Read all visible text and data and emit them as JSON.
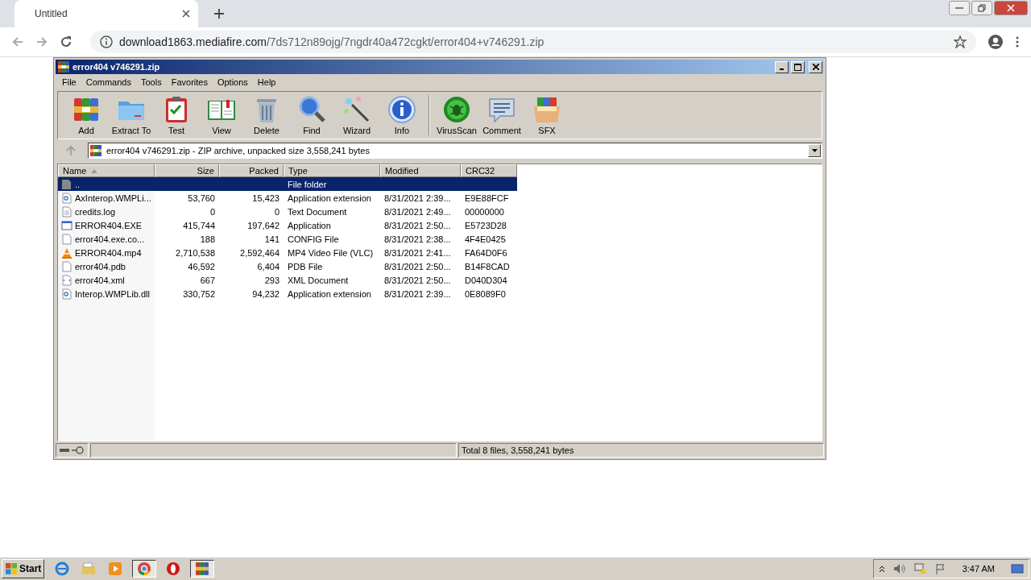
{
  "browser": {
    "tab": {
      "title": "Untitled"
    },
    "address": {
      "host": "download1863.mediafire.com",
      "path": "/7ds712n89ojg/7ngdr40a472cgkt/error404+v746291.zip"
    }
  },
  "window": {
    "title": "error404 v746291.zip",
    "menu": [
      "File",
      "Commands",
      "Tools",
      "Favorites",
      "Options",
      "Help"
    ],
    "toolbar": [
      {
        "label": "Add",
        "kind": "add"
      },
      {
        "label": "Extract To",
        "kind": "extract"
      },
      {
        "label": "Test",
        "kind": "test"
      },
      {
        "label": "View",
        "kind": "view"
      },
      {
        "label": "Delete",
        "kind": "delete"
      },
      {
        "label": "Find",
        "kind": "find"
      },
      {
        "label": "Wizard",
        "kind": "wizard"
      },
      {
        "label": "Info",
        "kind": "info"
      },
      {
        "label": "VirusScan",
        "kind": "virus",
        "group_start": true
      },
      {
        "label": "Comment",
        "kind": "comment"
      },
      {
        "label": "SFX",
        "kind": "sfx"
      }
    ],
    "path": "error404 v746291.zip - ZIP archive, unpacked size 3,558,241 bytes",
    "table": {
      "columns": [
        {
          "label": "Name",
          "sorted": true
        },
        {
          "label": "Size",
          "sorted": false
        },
        {
          "label": "Packed",
          "sorted": false
        },
        {
          "label": "Type",
          "sorted": false
        },
        {
          "label": "Modified",
          "sorted": false
        },
        {
          "label": "CRC32",
          "sorted": false
        }
      ],
      "rows": [
        {
          "kind": "folder",
          "name": "..",
          "size": "",
          "packed": "",
          "type": "File folder",
          "modified": "",
          "crc": "",
          "selected": true
        },
        {
          "kind": "dll",
          "name": "AxInterop.WMPLi...",
          "size": "53,760",
          "packed": "15,423",
          "type": "Application extension",
          "modified": "8/31/2021 2:39...",
          "crc": "E9E88FCF",
          "selected": false
        },
        {
          "kind": "text",
          "name": "credits.log",
          "size": "0",
          "packed": "0",
          "type": "Text Document",
          "modified": "8/31/2021 2:49...",
          "crc": "00000000",
          "selected": false
        },
        {
          "kind": "exe",
          "name": "ERROR404.EXE",
          "size": "415,744",
          "packed": "197,642",
          "type": "Application",
          "modified": "8/31/2021 2:50...",
          "crc": "E5723D28",
          "selected": false
        },
        {
          "kind": "blank",
          "name": "error404.exe.co...",
          "size": "188",
          "packed": "141",
          "type": "CONFIG File",
          "modified": "8/31/2021 2:38...",
          "crc": "4F4E0425",
          "selected": false
        },
        {
          "kind": "video",
          "name": "ERROR404.mp4",
          "size": "2,710,538",
          "packed": "2,592,464",
          "type": "MP4 Video File (VLC)",
          "modified": "8/31/2021 2:41...",
          "crc": "FA64D0F6",
          "selected": false
        },
        {
          "kind": "blank",
          "name": "error404.pdb",
          "size": "46,592",
          "packed": "6,404",
          "type": "PDB File",
          "modified": "8/31/2021 2:50...",
          "crc": "B14F8CAD",
          "selected": false
        },
        {
          "kind": "xml",
          "name": "error404.xml",
          "size": "667",
          "packed": "293",
          "type": "XML Document",
          "modified": "8/31/2021 2:50...",
          "crc": "D040D304",
          "selected": false
        },
        {
          "kind": "dll",
          "name": "Interop.WMPLib.dll",
          "size": "330,752",
          "packed": "94,232",
          "type": "Application extension",
          "modified": "8/31/2021 2:39...",
          "crc": "0E8089F0",
          "selected": false
        }
      ]
    },
    "status": "Total 8 files, 3,558,241 bytes"
  },
  "taskbar": {
    "start": "Start",
    "apps": [
      {
        "kind": "ie",
        "selected": false
      },
      {
        "kind": "explorer",
        "selected": false
      },
      {
        "kind": "media",
        "selected": false
      },
      {
        "kind": "chrome",
        "selected": true
      },
      {
        "kind": "opera",
        "selected": false
      },
      {
        "kind": "winrar",
        "selected": true
      }
    ],
    "clock": "3:47 AM"
  }
}
